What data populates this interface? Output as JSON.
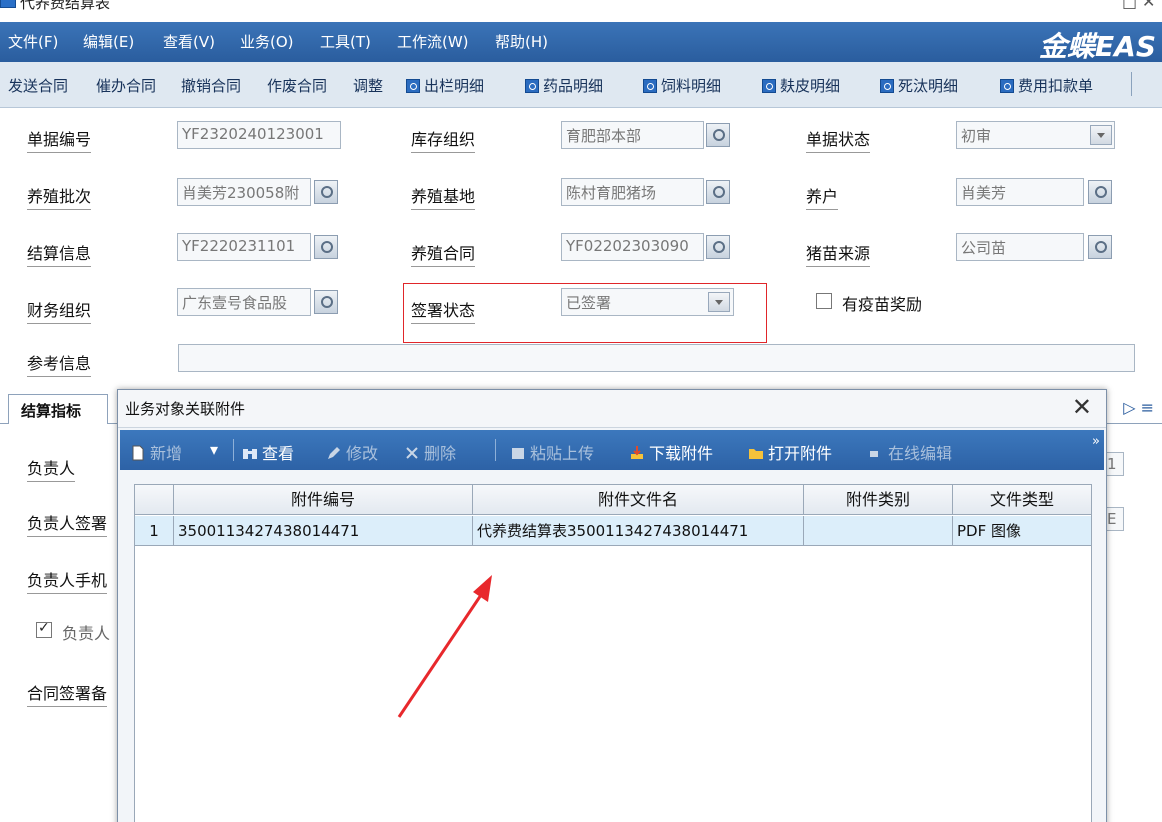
{
  "window": {
    "title": "代养费结算表",
    "min_glyph": "□",
    "close_glyph": "✕"
  },
  "menu": {
    "items": [
      "文件(F)",
      "编辑(E)",
      "查看(V)",
      "业务(O)",
      "工具(T)",
      "工作流(W)",
      "帮助(H)"
    ],
    "brand": "金蝶EAS"
  },
  "toolbar": {
    "items": [
      "发送合同",
      "催办合同",
      "撤销合同",
      "作废合同",
      "调整",
      "出栏明细",
      "药品明细",
      "饲料明细",
      "麸皮明细",
      "死汰明细",
      "费用扣款单"
    ]
  },
  "form": {
    "doc_no_label": "单据编号",
    "doc_no": "YF2320240123001",
    "stock_org_label": "库存组织",
    "stock_org": "育肥部本部",
    "doc_status_label": "单据状态",
    "doc_status": "初审",
    "batch_label": "养殖批次",
    "batch": "肖美芳230058附",
    "base_label": "养殖基地",
    "base": "陈村育肥猪场",
    "farmer_label": "养户",
    "farmer": "肖美芳",
    "settle_label": "结算信息",
    "settle": "YF2220231101",
    "contract_label": "养殖合同",
    "contract": "YF02202303090",
    "source_label": "猪苗来源",
    "source": "公司苗",
    "fin_org_label": "财务组织",
    "fin_org": "广东壹号食品股",
    "sign_status_label": "签署状态",
    "sign_status": "已签署",
    "vaccine_label": "有疫苗奖励",
    "ref_label": "参考信息",
    "tab_label": "结算指标",
    "owner_label": "负责人",
    "owner_sign_label": "负责人签署",
    "owner_phone_label": "负责人手机",
    "owner_check_label": "负责人",
    "contract_remark_label": "合同签署备",
    "right_snip_1": "1",
    "right_snip_2": "E"
  },
  "dialog": {
    "title": "业务对象关联附件",
    "toolbar": {
      "new": "新增",
      "view": "查看",
      "edit": "修改",
      "delete": "删除",
      "paste": "粘贴上传",
      "download": "下载附件",
      "open": "打开附件",
      "online_edit": "在线编辑"
    },
    "columns": [
      "附件编号",
      "附件文件名",
      "附件类别",
      "文件类型"
    ],
    "rows": [
      {
        "index": "1",
        "id": "3500113427438014471",
        "name": "代养费结算表3500113427438014471",
        "category": "",
        "type": "PDF 图像"
      }
    ]
  },
  "colors": {
    "menu_bg": "#2a5d9e",
    "toolbar_bg": "#dfe8f1",
    "highlight": "#e0262a",
    "row_selected": "#dceefa"
  }
}
